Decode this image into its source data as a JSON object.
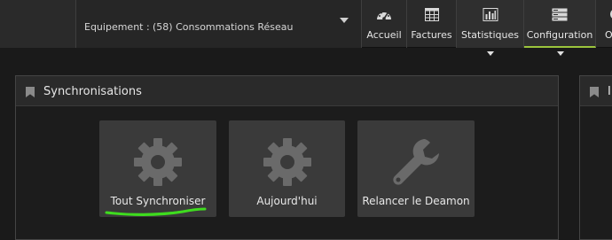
{
  "equipment": {
    "label": "Equipement :",
    "value": "(58) Consommations Réseau"
  },
  "nav": [
    {
      "label": "Accueil",
      "icon": "dashboard-icon"
    },
    {
      "label": "Factures",
      "icon": "table-icon"
    },
    {
      "label": "Statistiques",
      "icon": "bar-chart-icon"
    },
    {
      "label": "Configuration",
      "icon": "server-icon"
    },
    {
      "label": "O",
      "icon": "partial-icon"
    }
  ],
  "panel": {
    "title": "Synchronisations",
    "tiles": [
      {
        "label": "Tout Synchroniser",
        "icon": "gear-icon"
      },
      {
        "label": "Aujourd'hui",
        "icon": "gear-icon"
      },
      {
        "label": "Relancer le Deamon",
        "icon": "wrench-icon"
      }
    ]
  },
  "panel2": {
    "title": "I"
  },
  "colors": {
    "accent": "#9bc43c",
    "highlight": "#3fdc1f"
  }
}
